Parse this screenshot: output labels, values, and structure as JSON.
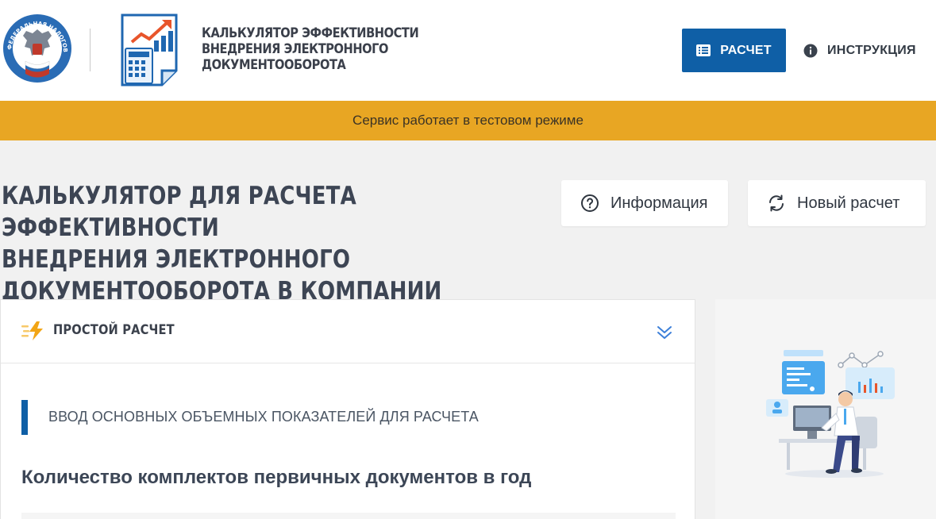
{
  "header": {
    "app_title": "КАЛЬКУЛЯТОР ЭФФЕКТИВНОСТИ\nВНЕДРЕНИЯ ЭЛЕКТРОННОГО\nДОКУМЕНТООБОРОТА",
    "fns_logo_text": "ФЕДЕРАЛЬНАЯ НАЛОГОВАЯ СЛУЖБА",
    "nav": {
      "calc_label": "РАСЧЕТ",
      "instruction_label": "ИНСТРУКЦИЯ"
    }
  },
  "banner": {
    "text": "Сервис работает в тестовом режиме"
  },
  "main": {
    "page_title": "КАЛЬКУЛЯТОР ДЛЯ РАСЧЕТА ЭФФЕКТИВНОСТИ\nВНЕДРЕНИЯ ЭЛЕКТРОННОГО\nДОКУМЕНТООБОРОТА В КОМПАНИИ",
    "info_button": "Информация",
    "new_calc_button": "Новый расчет"
  },
  "panel": {
    "label": "ПРОСТОЙ РАСЧЕТ",
    "section_label": "ВВОД ОСНОВНЫХ ОБЪЕМНЫХ ПОКАЗАТЕЛЕЙ ДЛЯ РАСЧЕТА",
    "field_title": "Количество комплектов первичных документов в год"
  },
  "colors": {
    "primary": "#0f5fa6",
    "banner": "#e8a623",
    "accent_bolt": "#f2a515"
  },
  "icons": [
    "fns-emblem-icon",
    "calculator-chart-icon",
    "list-icon",
    "info-icon",
    "question-icon",
    "refresh-icon",
    "bolt-icon",
    "chevron-double-down-icon"
  ]
}
